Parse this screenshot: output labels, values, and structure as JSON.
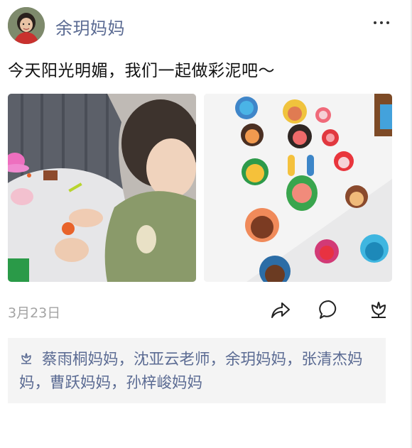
{
  "post": {
    "author": "余玥妈妈",
    "text": "今天阳光明媚，我们一起做彩泥吧～",
    "date": "3月23日",
    "likes_text": "蔡雨桐妈妈，沈亚云老师，余玥妈妈，张清杰妈妈，曹跃妈妈，孙梓峻妈妈"
  },
  "icons": {
    "more": "more-dots-icon",
    "share": "share-icon",
    "comment": "comment-icon",
    "like": "flower-like-icon"
  },
  "colors": {
    "name_blue": "#5b6b93",
    "date_gray": "#a3a3a3",
    "likes_bg": "#f4f4f4"
  }
}
